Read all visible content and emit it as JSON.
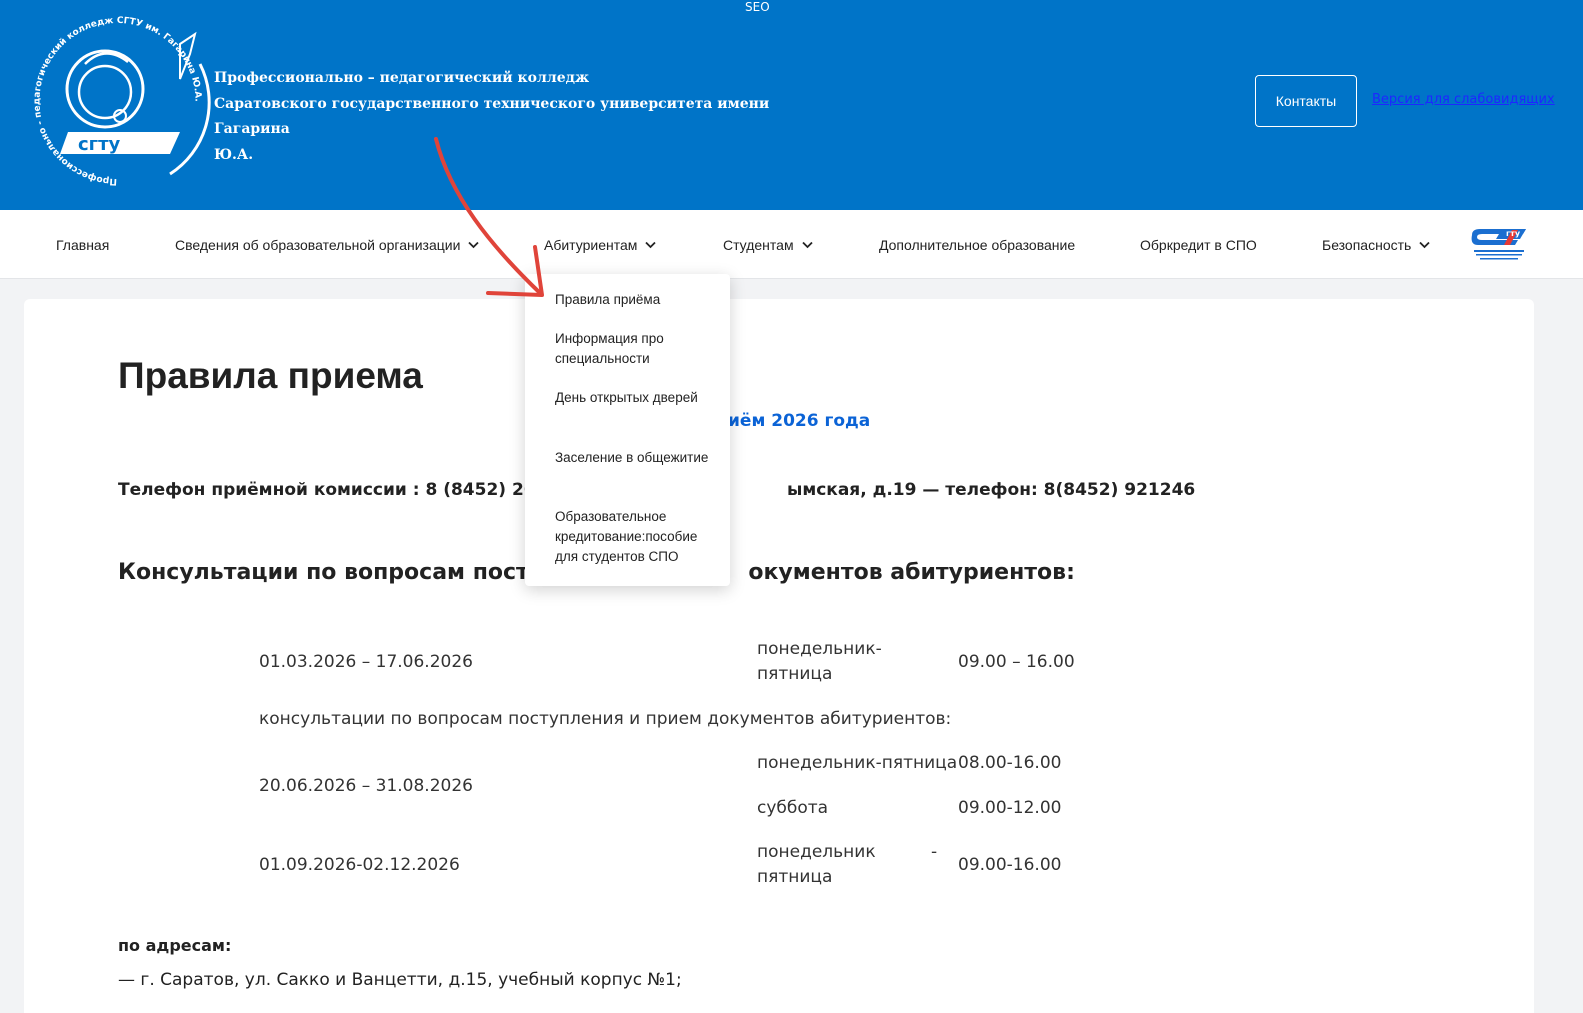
{
  "header": {
    "seo_label": "SEO",
    "title_lines": [
      "Профессионально – педагогический колледж",
      "Саратовского государственного технического университета имени Гагарина",
      "Ю.А."
    ],
    "contacts_label": "Контакты",
    "vision_link": "Версия для слабовидящих",
    "logo_ring_text": "Профессионально - педагогический колледж СГТУ им. Гагарина Ю.А.",
    "logo_mark": "сгту"
  },
  "nav": {
    "items": [
      {
        "label": "Главная"
      },
      {
        "label": "Сведения об образовательной организации"
      },
      {
        "label": "Абитуриентам"
      },
      {
        "label": "Студентам"
      },
      {
        "label": "Дополнительное образование"
      },
      {
        "label": "Обркредит в СПО"
      },
      {
        "label": "Безопасность"
      }
    ]
  },
  "dropdown": {
    "items": [
      {
        "label": "Правила приёма"
      },
      {
        "label": "Информация про специальности"
      },
      {
        "label": "День открытых дверей"
      },
      {
        "label": "Заселение в общежитие"
      },
      {
        "label": "Образовательное кредитование:пособие для студентов СПО"
      }
    ]
  },
  "content": {
    "title": "Правила приема",
    "year_link": "иём 2026 года",
    "phone_left": "Телефон приёмной комиссии : 8 (8452) 262507",
    "phone_right": "ымская, д.19 — телефон: 8(8452) 921246",
    "consult_left": "Консультации по вопросам поступ",
    "consult_right": "окументов абитуриентов:",
    "schedule": {
      "r1_dates": "01.03.2026 – 17.06.2026",
      "r1_days_a": "понедельник-",
      "r1_days_b": "пятница",
      "r1_time": "09.00 – 16.00",
      "note": "консультации по вопросам поступления и прием документов абитуриентов:",
      "r2_dates": "20.06.2026 – 31.08.2026",
      "r2_days": "понедельник-пятница",
      "r2_time": "08.00-16.00",
      "r3_days": "суббота",
      "r3_time": "09.00-12.00",
      "r4_dates": "01.09.2026-02.12.2026",
      "r4_days_a": "понедельник",
      "r4_dash": "-",
      "r4_days_b": "пятница",
      "r4_time": "09.00-16.00"
    },
    "address_title": "по адресам:",
    "address_1": "— г. Саратов, ул. Сакко и Ванцетти, д.15, учебный корпус №1;"
  },
  "colors": {
    "header_bg": "#0074c8",
    "link_blue": "#0b63d6",
    "annotation_arrow": "#e0443a"
  }
}
